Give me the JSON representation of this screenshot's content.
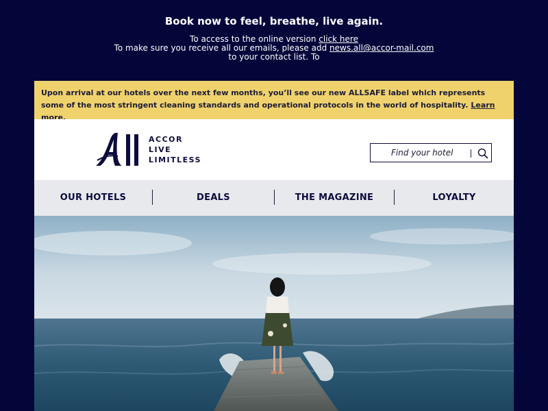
{
  "preheader": {
    "headline": "Book now to feel, breathe, live again.",
    "line1_prefix": "To access to the online version ",
    "line1_link": "click here",
    "line2_prefix": "To make sure you receive all our emails, please add ",
    "line2_link": "news.all@accor-mail.com",
    "line3": "to your contact list. To"
  },
  "notice": {
    "text": "Upon arrival at our hotels over the next few months, you’ll see our new ALLSAFE label which represents some of the most stringent cleaning standards and operational protocols in the world of hospitality. ",
    "link": "Learn more",
    "suffix": "."
  },
  "brand": {
    "logo_words": [
      "ACCOR",
      "LIVE",
      "LIMITLESS"
    ]
  },
  "search": {
    "placeholder": "Find your hotel"
  },
  "nav": {
    "items": [
      {
        "label": "OUR HOTELS"
      },
      {
        "label": "DEALS"
      },
      {
        "label": "THE MAGAZINE"
      },
      {
        "label": "LOYALTY"
      }
    ]
  },
  "colors": {
    "background": "#04063a",
    "notice_bg": "#f0d26d",
    "brand_navy": "#0c0b3d",
    "nav_bg": "#e8e9ec"
  },
  "icons": {
    "search": "search-icon"
  }
}
